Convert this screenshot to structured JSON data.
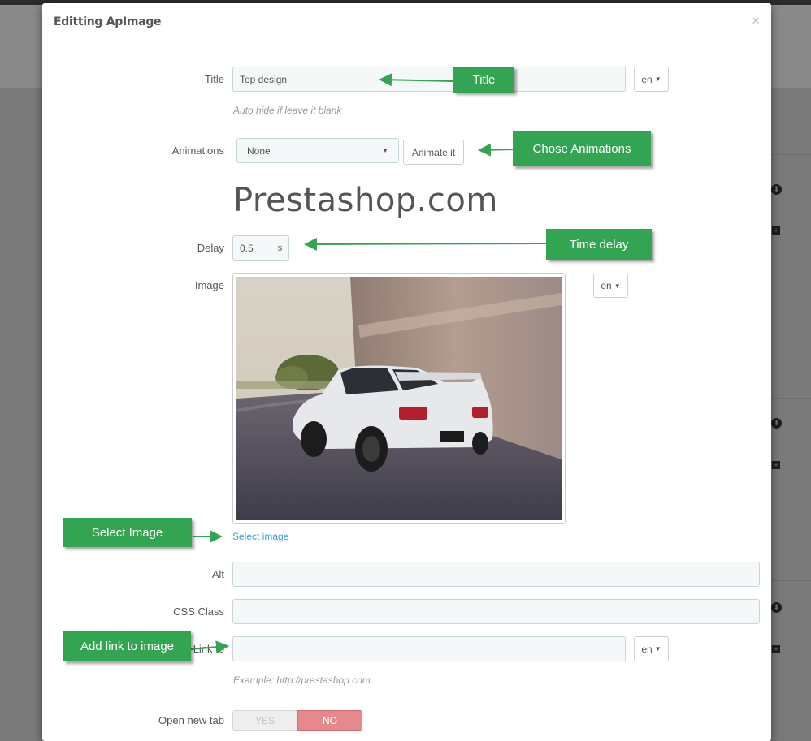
{
  "modal": {
    "title": "Editting ApImage",
    "close_icon": "×"
  },
  "form": {
    "title": {
      "label": "Title",
      "value": "Top design",
      "lang": "en",
      "help": "Auto hide if leave it blank"
    },
    "animations": {
      "label": "Animations",
      "selected": "None",
      "animate_button": "Animate it",
      "preview_text": "Prestashop.com"
    },
    "delay": {
      "label": "Delay",
      "value": "0.5",
      "unit": "s"
    },
    "image": {
      "label": "Image",
      "lang": "en",
      "select_link": "Select image"
    },
    "alt": {
      "label": "Alt",
      "value": ""
    },
    "css_class": {
      "label": "CSS Class",
      "value": ""
    },
    "link_to": {
      "label": "Link to",
      "value": "",
      "lang": "en",
      "help": "Example: http://prestashop.com"
    },
    "open_new_tab": {
      "label": "Open new tab",
      "yes": "YES",
      "no": "NO",
      "selected": "NO"
    }
  },
  "callouts": {
    "title": "Title",
    "animations": "Chose Animations",
    "delay": "Time delay",
    "select_image": "Select Image",
    "add_link": "Add link to image"
  },
  "colors": {
    "callout_green": "#33a452",
    "link_blue": "#3aa1d8",
    "toggle_no": "#e6898f",
    "input_bg": "#f5f8f9"
  }
}
